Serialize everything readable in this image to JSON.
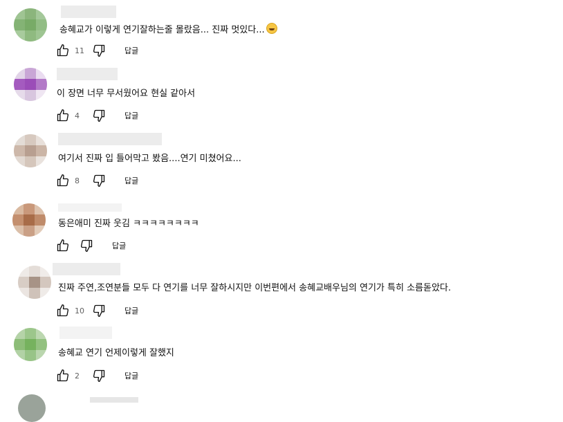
{
  "comments": [
    {
      "text": "송혜교가 이렇게 연기잘하는줄 몰랐음...  진짜 멋있다...",
      "has_emoji": true,
      "emoji_name": "grinning-face-emoji",
      "likes": "11",
      "reply_label": "답글",
      "avatar_colors": [
        "#9fc493",
        "#8bb57c",
        "#a4c89a",
        "#84b375",
        "#78ab67",
        "#92bd85",
        "#a8cb9d",
        "#8fba80",
        "#9ec592"
      ]
    },
    {
      "text": "이 장면 너무 무서웠어요  현실 같아서",
      "has_emoji": false,
      "likes": "4",
      "reply_label": "답글",
      "avatar_colors": [
        "#e2d4e8",
        "#c9a6d6",
        "#eadcf0",
        "#a45bbf",
        "#9b4db8",
        "#b37ac8",
        "#e6dbea",
        "#d8c6df",
        "#efe6f2"
      ]
    },
    {
      "text": "여기서 진짜 입 틀어막고 봤음....연기 미쳤어요...",
      "has_emoji": false,
      "likes": "8",
      "reply_label": "답글",
      "avatar_colors": [
        "#e3dcd6",
        "#d7c9bf",
        "#e8e0da",
        "#cdb8aa",
        "#b89f90",
        "#cbb5a6",
        "#e2d9d2",
        "#d5c6bb",
        "#e9e2dd"
      ]
    },
    {
      "text": "동은애미 진짜     웃김 ㅋㅋㅋㅋㅋㅋㅋㅋ",
      "has_emoji": false,
      "likes": "",
      "reply_label": "답글",
      "avatar_colors": [
        "#d9b9a0",
        "#c9987a",
        "#ddc2ad",
        "#c48f6e",
        "#a86c48",
        "#bf8b6a",
        "#dbbfa9",
        "#caa086",
        "#e2cbb8"
      ]
    },
    {
      "text": "진짜 주연,조연분들 모두 다 연기를 너무 잘하시지만 이번편에서 송혜교배우님의 연기가 특히 소름돋았다.",
      "has_emoji": false,
      "likes": "10",
      "reply_label": "답글",
      "avatar_colors": [
        "#eeeae7",
        "#e4ddd8",
        "#f0ece9",
        "#d8cdc5",
        "#a79386",
        "#d4c7be",
        "#ebe5e1",
        "#cfc2b9",
        "#efebe8"
      ]
    },
    {
      "text": "송혜교  연기 언제이렇게 잘했지",
      "has_emoji": false,
      "likes": "2",
      "reply_label": "답글",
      "avatar_colors": [
        "#b5d3a8",
        "#9cc68b",
        "#bcd7b0",
        "#8dbd78",
        "#76b25e",
        "#93c180",
        "#b2d2a5",
        "#98c487",
        "#bad6ae"
      ]
    }
  ]
}
